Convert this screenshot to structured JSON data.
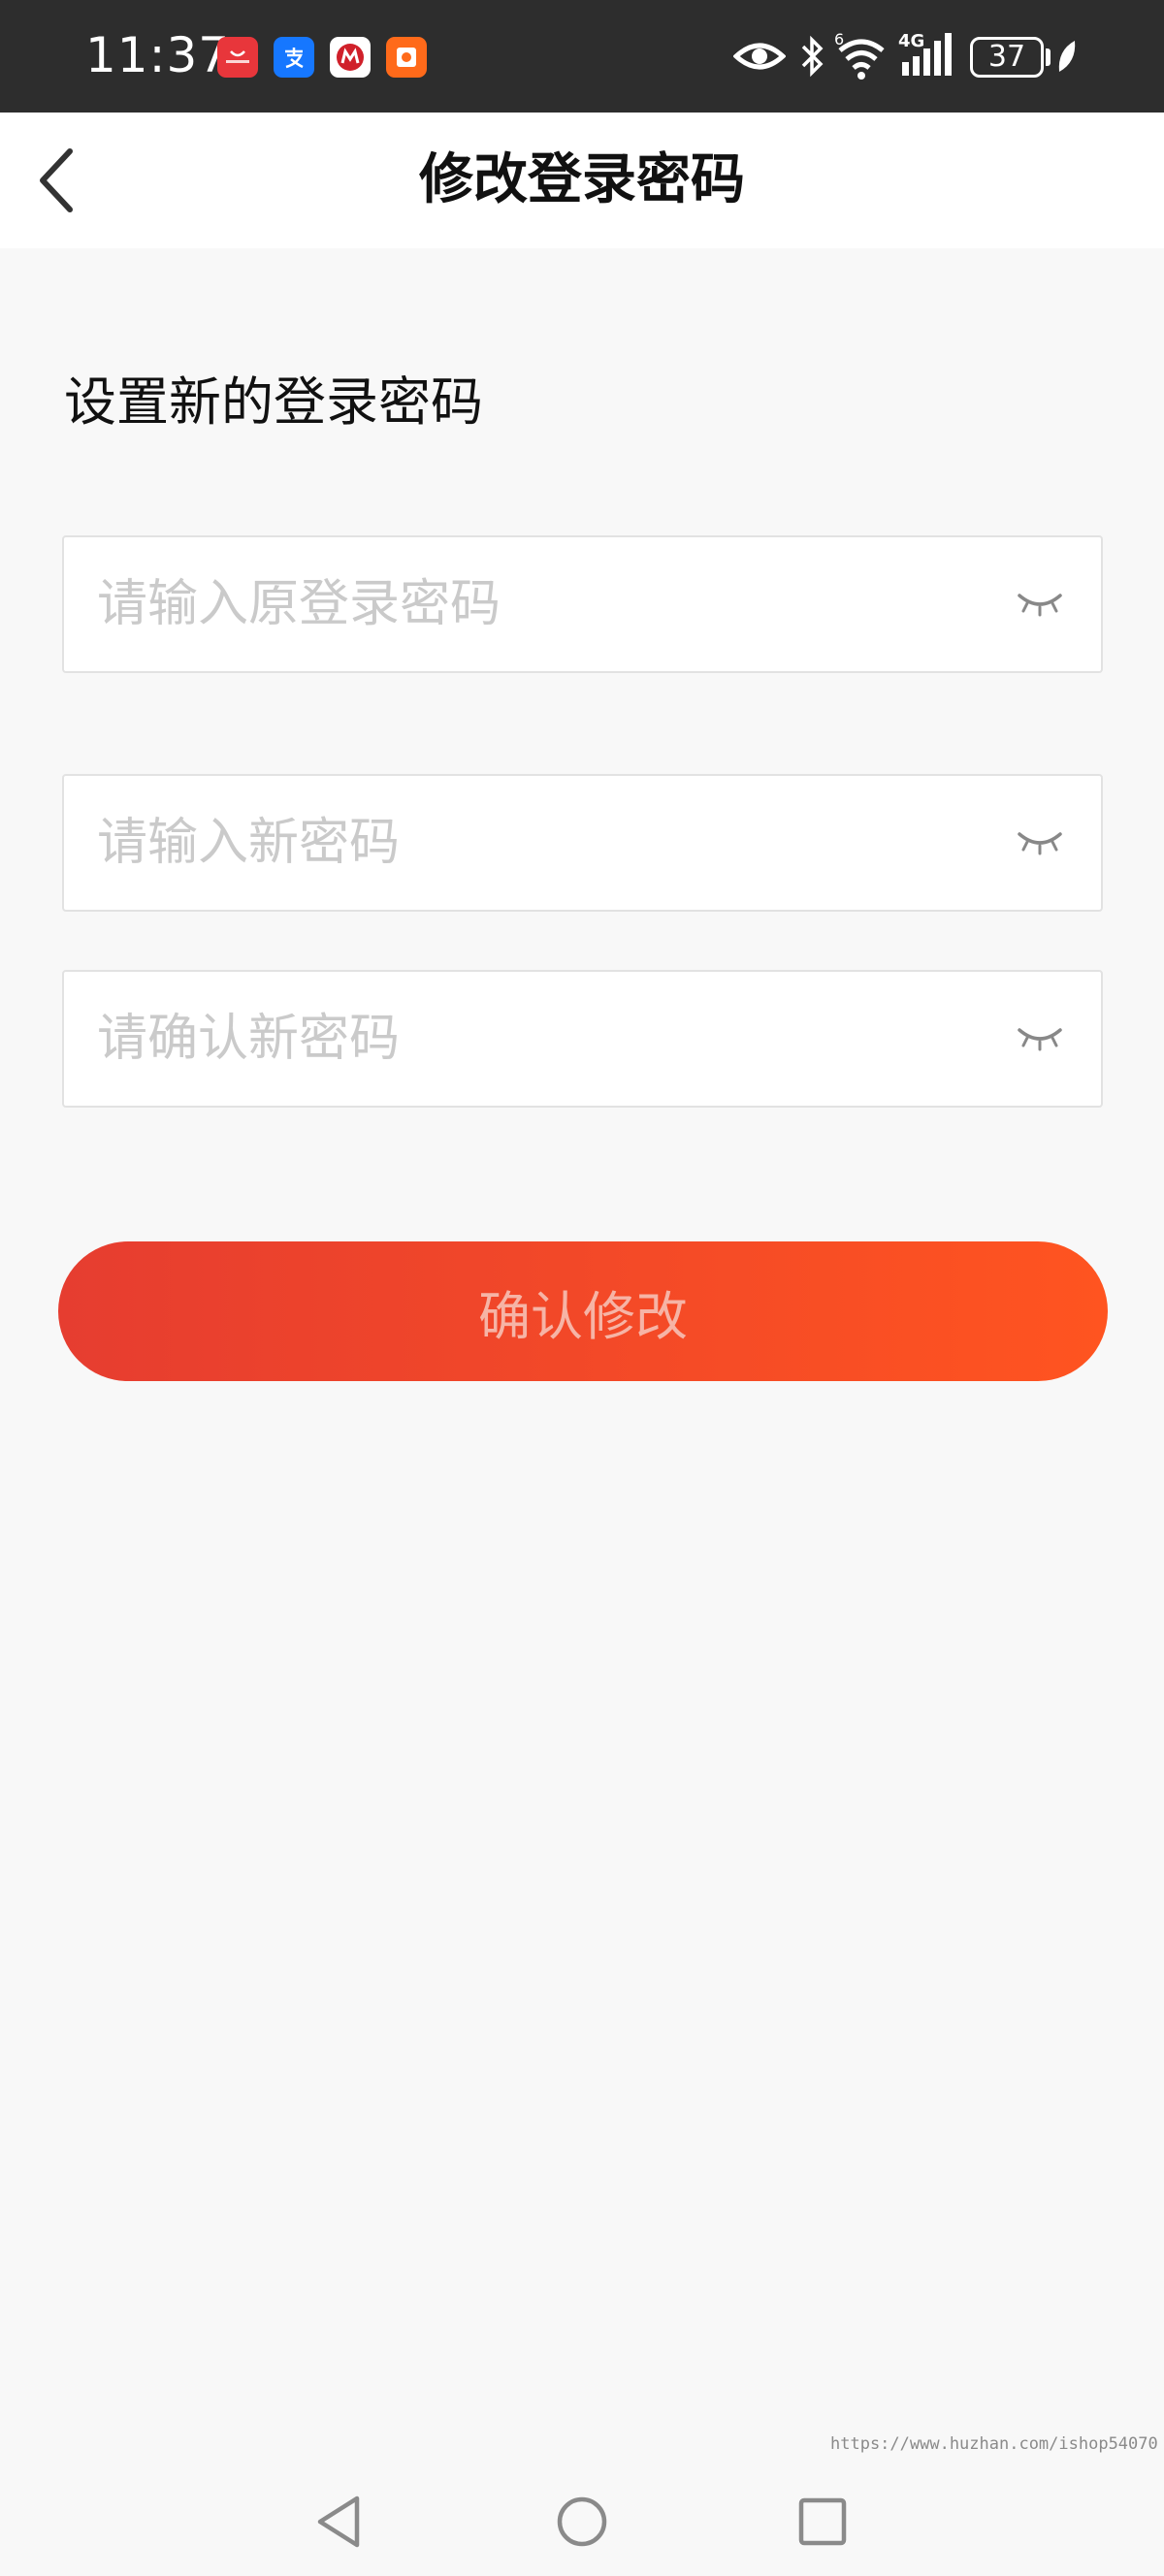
{
  "status_bar": {
    "time": "11:37",
    "network": "4G",
    "wifi_badge": "6",
    "battery": "37",
    "icons": [
      "huawei-appgallery-icon",
      "alipay-icon",
      "cmb-bank-icon",
      "red-envelope-icon",
      "eye-icon",
      "bluetooth-icon",
      "wifi-icon",
      "signal-icon",
      "battery-icon",
      "leaf-icon"
    ]
  },
  "header": {
    "title": "修改登录密码",
    "back_icon": "chevron-left-icon"
  },
  "main": {
    "section_title": "设置新的登录密码",
    "fields": [
      {
        "placeholder": "请输入原登录密码",
        "value": "",
        "icon": "eye-closed-icon"
      },
      {
        "placeholder": "请输入新密码",
        "value": "",
        "icon": "eye-closed-icon"
      },
      {
        "placeholder": "请确认新密码",
        "value": "",
        "icon": "eye-closed-icon"
      }
    ],
    "submit_label": "确认修改"
  },
  "watermark": "https://www.huzhan.com/ishop54070",
  "nav_bar": {
    "icons": [
      "back-triangle-icon",
      "home-circle-icon",
      "recents-square-icon"
    ]
  },
  "colors": {
    "status_bar_bg": "#2d2d2d",
    "page_bg": "#f8f8f8",
    "button_gradient_start": "#e63d30",
    "button_gradient_end": "#ff5420",
    "button_text": "#f6b4a6",
    "placeholder": "#cacaca"
  }
}
